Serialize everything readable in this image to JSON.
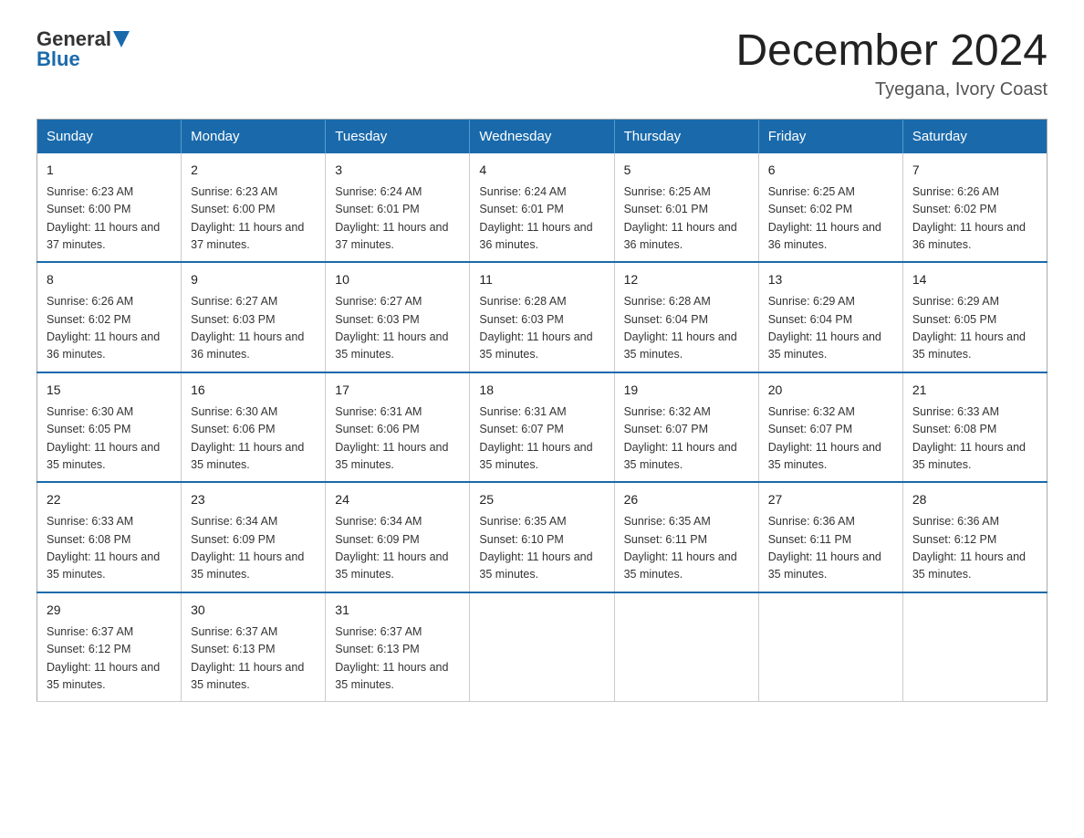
{
  "logo": {
    "general": "General",
    "blue": "Blue"
  },
  "title": {
    "month": "December 2024",
    "location": "Tyegana, Ivory Coast"
  },
  "days_of_week": [
    "Sunday",
    "Monday",
    "Tuesday",
    "Wednesday",
    "Thursday",
    "Friday",
    "Saturday"
  ],
  "weeks": [
    [
      {
        "day": "1",
        "sunrise": "6:23 AM",
        "sunset": "6:00 PM",
        "daylight": "11 hours and 37 minutes."
      },
      {
        "day": "2",
        "sunrise": "6:23 AM",
        "sunset": "6:00 PM",
        "daylight": "11 hours and 37 minutes."
      },
      {
        "day": "3",
        "sunrise": "6:24 AM",
        "sunset": "6:01 PM",
        "daylight": "11 hours and 37 minutes."
      },
      {
        "day": "4",
        "sunrise": "6:24 AM",
        "sunset": "6:01 PM",
        "daylight": "11 hours and 36 minutes."
      },
      {
        "day": "5",
        "sunrise": "6:25 AM",
        "sunset": "6:01 PM",
        "daylight": "11 hours and 36 minutes."
      },
      {
        "day": "6",
        "sunrise": "6:25 AM",
        "sunset": "6:02 PM",
        "daylight": "11 hours and 36 minutes."
      },
      {
        "day": "7",
        "sunrise": "6:26 AM",
        "sunset": "6:02 PM",
        "daylight": "11 hours and 36 minutes."
      }
    ],
    [
      {
        "day": "8",
        "sunrise": "6:26 AM",
        "sunset": "6:02 PM",
        "daylight": "11 hours and 36 minutes."
      },
      {
        "day": "9",
        "sunrise": "6:27 AM",
        "sunset": "6:03 PM",
        "daylight": "11 hours and 36 minutes."
      },
      {
        "day": "10",
        "sunrise": "6:27 AM",
        "sunset": "6:03 PM",
        "daylight": "11 hours and 35 minutes."
      },
      {
        "day": "11",
        "sunrise": "6:28 AM",
        "sunset": "6:03 PM",
        "daylight": "11 hours and 35 minutes."
      },
      {
        "day": "12",
        "sunrise": "6:28 AM",
        "sunset": "6:04 PM",
        "daylight": "11 hours and 35 minutes."
      },
      {
        "day": "13",
        "sunrise": "6:29 AM",
        "sunset": "6:04 PM",
        "daylight": "11 hours and 35 minutes."
      },
      {
        "day": "14",
        "sunrise": "6:29 AM",
        "sunset": "6:05 PM",
        "daylight": "11 hours and 35 minutes."
      }
    ],
    [
      {
        "day": "15",
        "sunrise": "6:30 AM",
        "sunset": "6:05 PM",
        "daylight": "11 hours and 35 minutes."
      },
      {
        "day": "16",
        "sunrise": "6:30 AM",
        "sunset": "6:06 PM",
        "daylight": "11 hours and 35 minutes."
      },
      {
        "day": "17",
        "sunrise": "6:31 AM",
        "sunset": "6:06 PM",
        "daylight": "11 hours and 35 minutes."
      },
      {
        "day": "18",
        "sunrise": "6:31 AM",
        "sunset": "6:07 PM",
        "daylight": "11 hours and 35 minutes."
      },
      {
        "day": "19",
        "sunrise": "6:32 AM",
        "sunset": "6:07 PM",
        "daylight": "11 hours and 35 minutes."
      },
      {
        "day": "20",
        "sunrise": "6:32 AM",
        "sunset": "6:07 PM",
        "daylight": "11 hours and 35 minutes."
      },
      {
        "day": "21",
        "sunrise": "6:33 AM",
        "sunset": "6:08 PM",
        "daylight": "11 hours and 35 minutes."
      }
    ],
    [
      {
        "day": "22",
        "sunrise": "6:33 AM",
        "sunset": "6:08 PM",
        "daylight": "11 hours and 35 minutes."
      },
      {
        "day": "23",
        "sunrise": "6:34 AM",
        "sunset": "6:09 PM",
        "daylight": "11 hours and 35 minutes."
      },
      {
        "day": "24",
        "sunrise": "6:34 AM",
        "sunset": "6:09 PM",
        "daylight": "11 hours and 35 minutes."
      },
      {
        "day": "25",
        "sunrise": "6:35 AM",
        "sunset": "6:10 PM",
        "daylight": "11 hours and 35 minutes."
      },
      {
        "day": "26",
        "sunrise": "6:35 AM",
        "sunset": "6:11 PM",
        "daylight": "11 hours and 35 minutes."
      },
      {
        "day": "27",
        "sunrise": "6:36 AM",
        "sunset": "6:11 PM",
        "daylight": "11 hours and 35 minutes."
      },
      {
        "day": "28",
        "sunrise": "6:36 AM",
        "sunset": "6:12 PM",
        "daylight": "11 hours and 35 minutes."
      }
    ],
    [
      {
        "day": "29",
        "sunrise": "6:37 AM",
        "sunset": "6:12 PM",
        "daylight": "11 hours and 35 minutes."
      },
      {
        "day": "30",
        "sunrise": "6:37 AM",
        "sunset": "6:13 PM",
        "daylight": "11 hours and 35 minutes."
      },
      {
        "day": "31",
        "sunrise": "6:37 AM",
        "sunset": "6:13 PM",
        "daylight": "11 hours and 35 minutes."
      },
      null,
      null,
      null,
      null
    ]
  ]
}
